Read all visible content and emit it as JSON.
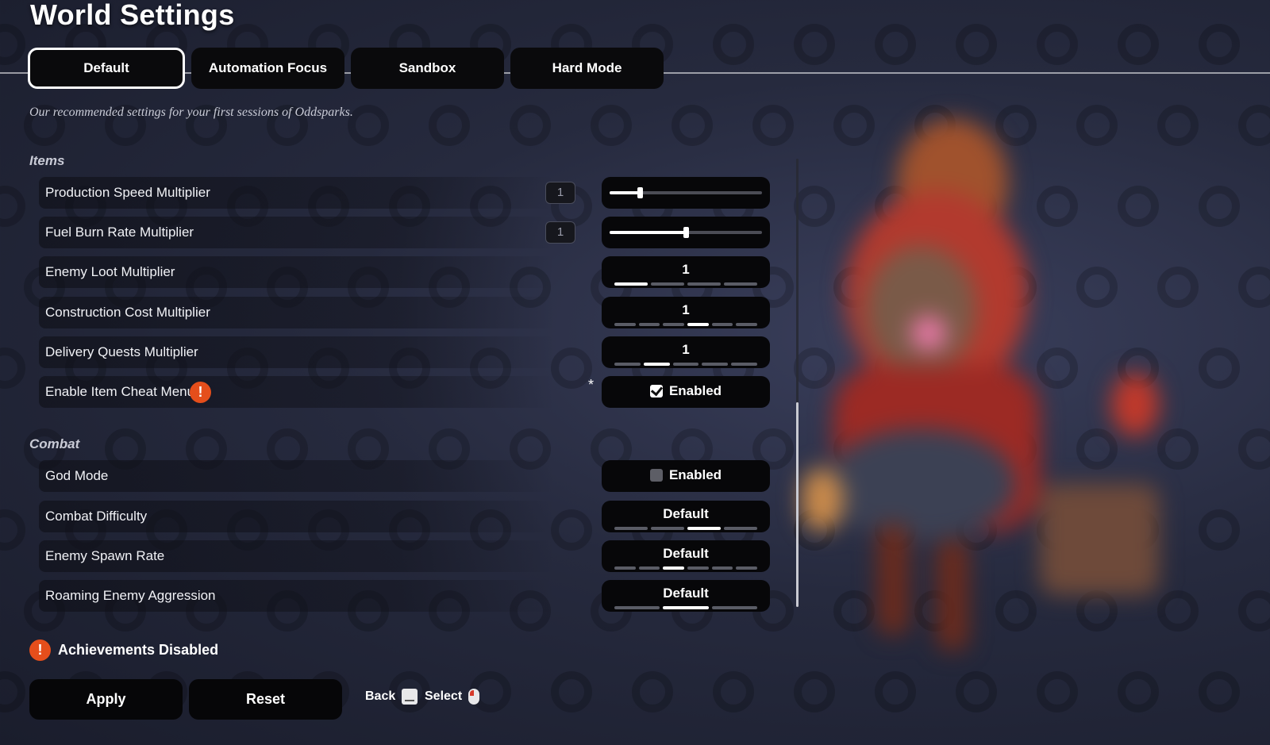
{
  "title": "World Settings",
  "tabs": [
    {
      "label": "Default",
      "active": true
    },
    {
      "label": "Automation Focus",
      "active": false
    },
    {
      "label": "Sandbox",
      "active": false
    },
    {
      "label": "Hard Mode",
      "active": false
    }
  ],
  "description": "Our recommended settings for your first sessions of Oddsparks.",
  "sections": {
    "items": {
      "label": "Items",
      "rows": [
        {
          "label": "Production Speed Multiplier",
          "control": "slider",
          "value": "1",
          "slider_fraction": 0.2
        },
        {
          "label": "Fuel Burn Rate Multiplier",
          "control": "slider",
          "value": "1",
          "slider_fraction": 0.5
        },
        {
          "label": "Enemy Loot Multiplier",
          "control": "stepper",
          "value": "1",
          "steps": 4,
          "selected_step": 1
        },
        {
          "label": "Construction Cost Multiplier",
          "control": "stepper",
          "value": "1",
          "steps": 6,
          "selected_step": 4
        },
        {
          "label": "Delivery Quests Multiplier",
          "control": "stepper",
          "value": "1",
          "steps": 5,
          "selected_step": 2
        },
        {
          "label": "Enable Item Cheat Menu",
          "control": "checkbox",
          "checked": true,
          "value": "Enabled",
          "warning_icon": "exclamation-icon",
          "modified_marker": "*"
        }
      ]
    },
    "combat": {
      "label": "Combat",
      "rows": [
        {
          "label": "God Mode",
          "control": "checkbox",
          "checked": false,
          "value": "Enabled"
        },
        {
          "label": "Combat Difficulty",
          "control": "stepper",
          "value": "Default",
          "steps": 4,
          "selected_step": 3
        },
        {
          "label": "Enemy Spawn Rate",
          "control": "stepper",
          "value": "Default",
          "steps": 6,
          "selected_step": 3
        },
        {
          "label": "Roaming Enemy Aggression",
          "control": "stepper",
          "value": "Default",
          "steps": 3,
          "selected_step": 2
        }
      ]
    }
  },
  "achievements": {
    "text": "Achievements Disabled",
    "icon": "exclamation-icon"
  },
  "buttons": {
    "apply": "Apply",
    "reset": "Reset"
  },
  "hints": {
    "back": "Back",
    "back_icon": "keyboard-key-icon",
    "select": "Select",
    "select_icon": "mouse-left-click-icon"
  },
  "colors": {
    "warning": "#e54e1b",
    "control_bg": "#070709",
    "pip_off": "#5a5c66",
    "pip_on": "#ffffff"
  }
}
